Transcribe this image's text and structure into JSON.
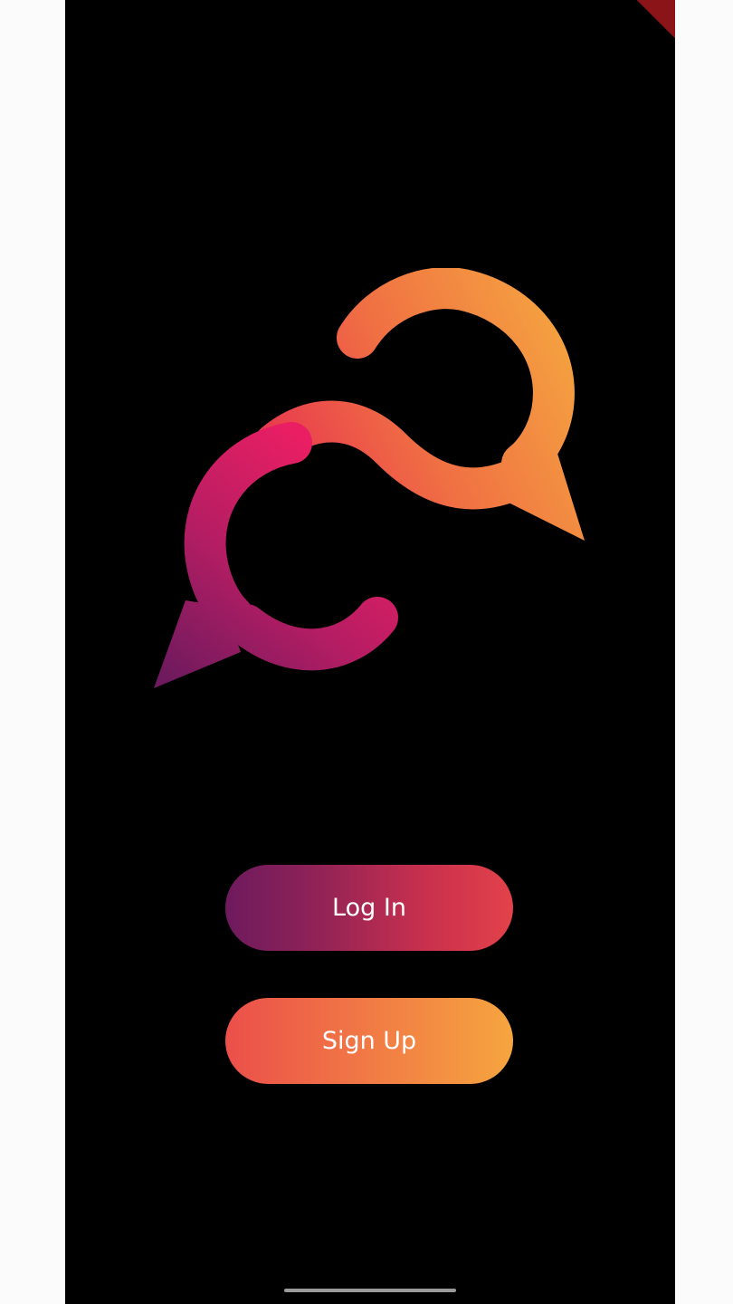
{
  "app": {
    "logo_icon": "chat-bubbles-logo",
    "colors": {
      "background": "#000000",
      "gradient_purple": "#6e1a5e",
      "gradient_pink": "#e91e63",
      "gradient_orange": "#f17a45",
      "gradient_yellow": "#f6a53f"
    }
  },
  "actions": {
    "login_label": "Log In",
    "signup_label": "Sign Up"
  }
}
